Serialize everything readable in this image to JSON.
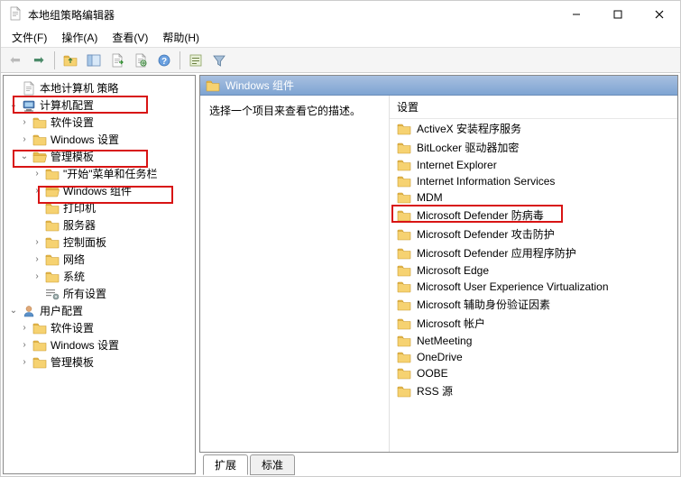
{
  "window": {
    "title": "本地组策略编辑器"
  },
  "menu": {
    "file": "文件(F)",
    "action": "操作(A)",
    "view": "查看(V)",
    "help": "帮助(H)"
  },
  "toolbar_icons": {
    "back": "back-arrow",
    "forward": "forward-arrow",
    "up": "up-folder",
    "show_hide_tree": "show-hide-tree",
    "export_list": "export-list",
    "properties": "properties",
    "help": "help",
    "filter_options": "filter-options",
    "filter": "filter"
  },
  "tree": {
    "root": "本地计算机 策略",
    "computer_config": "计算机配置",
    "cc_software": "软件设置",
    "cc_windows": "Windows 设置",
    "cc_admin": "管理模板",
    "cc_at_start": "\"开始\"菜单和任务栏",
    "cc_at_wincomp": "Windows 组件",
    "cc_at_printers": "打印机",
    "cc_at_servers": "服务器",
    "cc_at_cpanel": "控制面板",
    "cc_at_network": "网络",
    "cc_at_system": "系统",
    "cc_at_all": "所有设置",
    "user_config": "用户配置",
    "uc_software": "软件设置",
    "uc_windows": "Windows 设置",
    "uc_admin": "管理模板"
  },
  "right": {
    "heading": "Windows 组件",
    "description": "选择一个项目来查看它的描述。",
    "column_header": "设置",
    "items": [
      "ActiveX 安装程序服务",
      "BitLocker 驱动器加密",
      "Internet Explorer",
      "Internet Information Services",
      "MDM",
      "Microsoft Defender 防病毒",
      "Microsoft Defender 攻击防护",
      "Microsoft Defender 应用程序防护",
      "Microsoft Edge",
      "Microsoft User Experience Virtualization",
      "Microsoft 辅助身份验证因素",
      "Microsoft 帐户",
      "NetMeeting",
      "OneDrive",
      "OOBE",
      "RSS 源"
    ],
    "highlight_index": 5
  },
  "tabs": {
    "extended": "扩展",
    "standard": "标准"
  },
  "colors": {
    "highlight": "#d81414",
    "header_grad_start": "#a8c0e0",
    "header_grad_end": "#7ea4d2",
    "folder_fill": "#f6d271",
    "folder_tab": "#e8b84a"
  }
}
